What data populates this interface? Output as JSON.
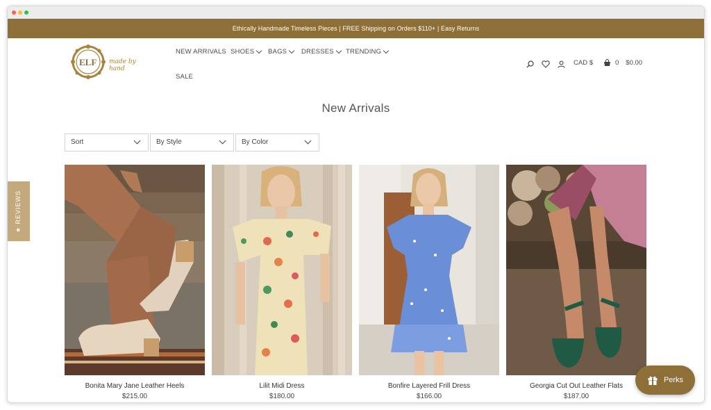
{
  "promo_bar": {
    "text": "Ethically Handmade Timeless Pieces | FREE Shipping on Orders $110+ | Easy Returns"
  },
  "brand": {
    "logo_letters": "ELF",
    "tagline": "made by hand"
  },
  "nav": {
    "items": [
      {
        "label": "NEW ARRIVALS",
        "has_dropdown": false
      },
      {
        "label": "SHOES",
        "has_dropdown": true
      },
      {
        "label": "BAGS",
        "has_dropdown": true
      },
      {
        "label": "DRESSES",
        "has_dropdown": true
      },
      {
        "label": "TRENDING",
        "has_dropdown": true
      },
      {
        "label": "SALE",
        "has_dropdown": false
      }
    ]
  },
  "utility": {
    "icons": [
      "search-icon",
      "heart-icon",
      "user-icon",
      "cart-icon"
    ],
    "currency": "CAD $",
    "cart_count": "0",
    "cart_total": "$0.00"
  },
  "page": {
    "title": "New Arrivals"
  },
  "filters": [
    {
      "label": "Sort"
    },
    {
      "label": "By Style"
    },
    {
      "label": "By Color"
    }
  ],
  "products": [
    {
      "name": "Bonita Mary Jane Leather Heels",
      "price": "$215.00"
    },
    {
      "name": "Lilit Midi Dress",
      "price": "$180.00"
    },
    {
      "name": "Bonfire Layered Frill Dress",
      "price": "$166.00"
    },
    {
      "name": "Georgia Cut Out Leather Flats",
      "price": "$187.00"
    }
  ],
  "reviews_tab": {
    "label": "★ REVIEWS"
  },
  "perks_button": {
    "label": "Perks"
  },
  "colors": {
    "brand": "#8d6f37",
    "reviews_tab": "#c4a97c",
    "text": "#4a4a4a"
  }
}
